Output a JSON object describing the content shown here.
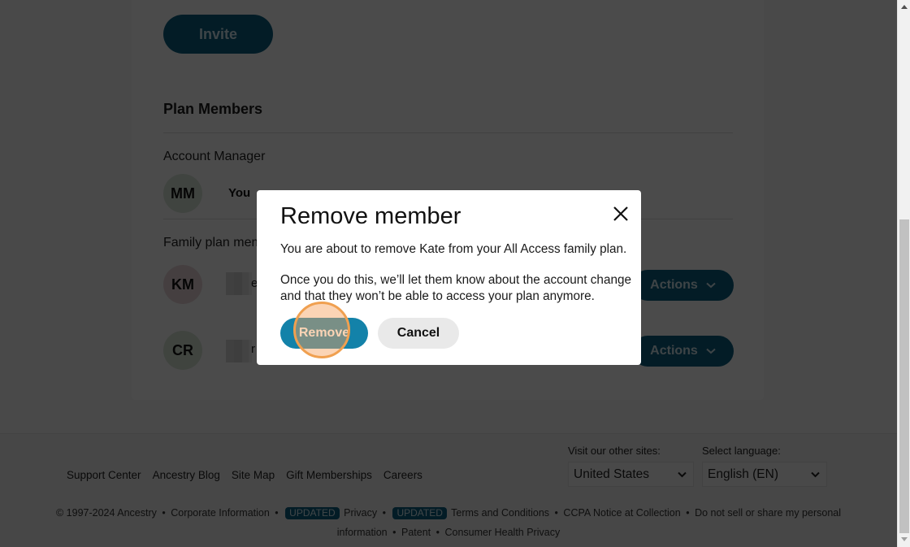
{
  "main": {
    "invite_label": "Invite",
    "section_title": "Plan Members",
    "account_manager": {
      "label": "Account Manager",
      "member": {
        "initials": "MM",
        "name": "You",
        "avatar_color": "#d7e3d5"
      }
    },
    "family_members": {
      "label": "Family plan members",
      "members": [
        {
          "initials": "KM",
          "name_tail": "e",
          "avatar_color": "#e8d3d8",
          "actions_label": "Actions"
        },
        {
          "initials": "CR",
          "name_tail": "r",
          "avatar_color": "#d6e3d4",
          "actions_label": "Actions"
        }
      ]
    }
  },
  "modal": {
    "title": "Remove member",
    "message": "You are about to remove Kate from your All Access family plan.",
    "detail_line1": "Once you do this, we’ll let them know about the account change",
    "detail_line2": "and that they won’t be able to access your plan anymore.",
    "remove_label": "Remove",
    "cancel_label": "Cancel"
  },
  "footer": {
    "links": [
      "Support Center",
      "Ancestry Blog",
      "Site Map",
      "Gift Memberships",
      "Careers"
    ],
    "other_sites_label": "Visit our other sites:",
    "other_sites_value": "United States",
    "language_label": "Select language:",
    "language_value": "English (EN)",
    "legal": {
      "copyright": "© 1997-2024 Ancestry",
      "corporate": "Corporate Information",
      "badge": "UPDATED",
      "privacy": "Privacy",
      "terms": "Terms and Conditions",
      "ccpa": "CCPA Notice at Collection",
      "do_not_sell": "Do not sell or share my personal information",
      "do_not_sell_1": "Do not sell or share my personal",
      "do_not_sell_2": "information",
      "patent": "Patent",
      "health": "Consumer Health Privacy",
      "separator": "•"
    }
  },
  "colors": {
    "brand_button": "#0a5e80",
    "remove_button": "#1382a9",
    "click_indicator": "#f0a050"
  }
}
